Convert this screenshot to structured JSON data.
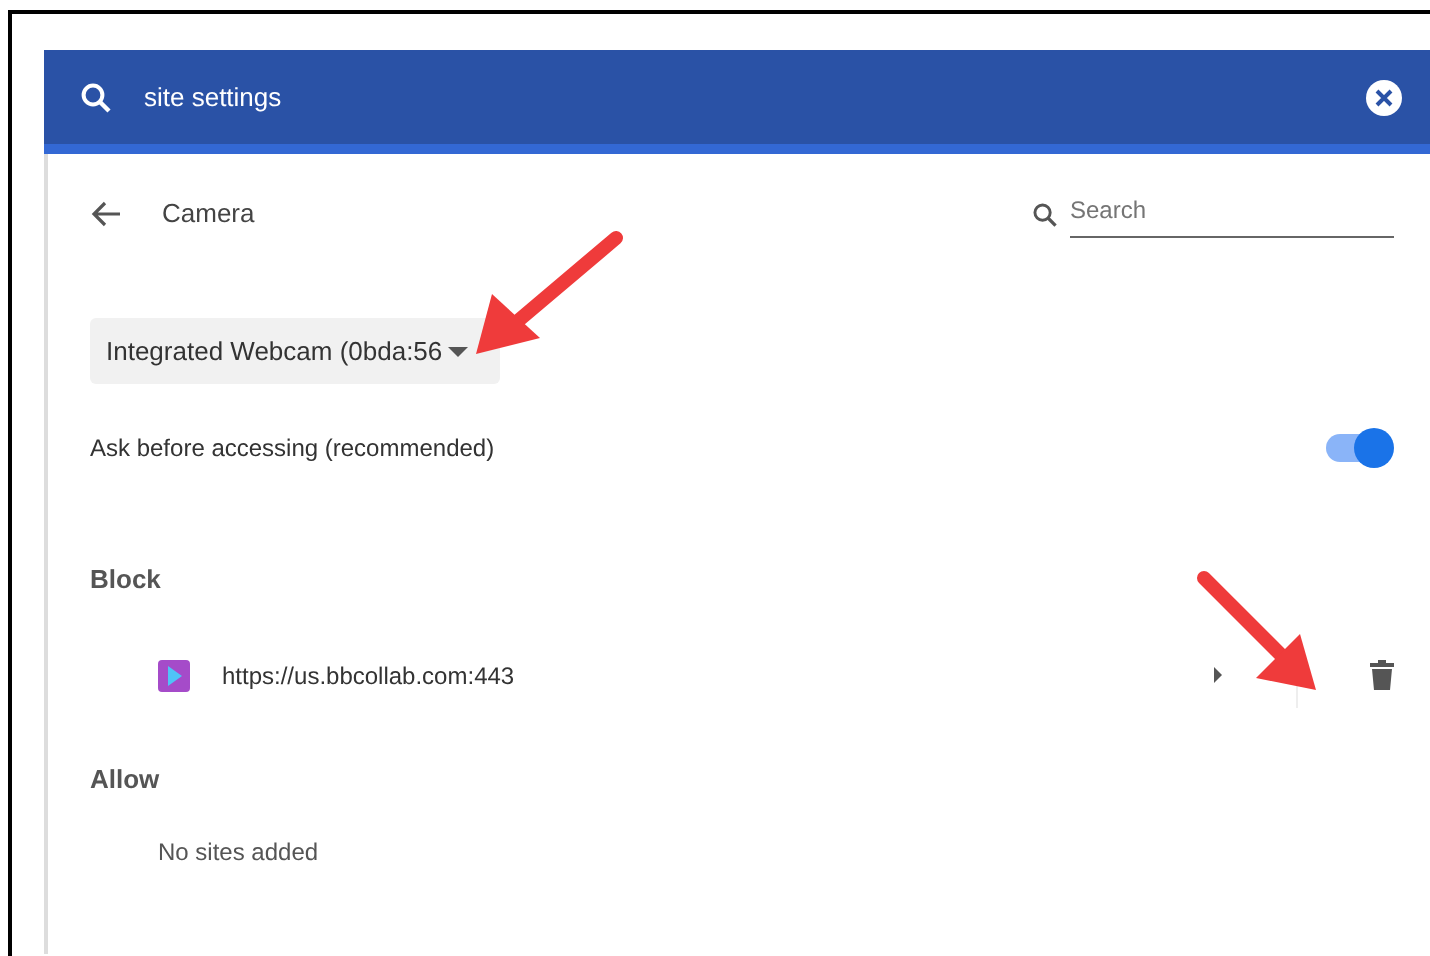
{
  "search_bar": {
    "value": "site settings"
  },
  "header": {
    "title": "Camera",
    "search": {
      "placeholder": "Search"
    }
  },
  "device_dropdown": {
    "value": "Integrated Webcam (0bda:56"
  },
  "ask_setting": {
    "label": "Ask before accessing (recommended)",
    "on": true
  },
  "sections": [
    {
      "title": "Block",
      "sites": [
        {
          "url": "https://us.bbcollab.com:443"
        }
      ]
    },
    {
      "title": "Allow",
      "empty_text": "No sites added"
    }
  ]
}
